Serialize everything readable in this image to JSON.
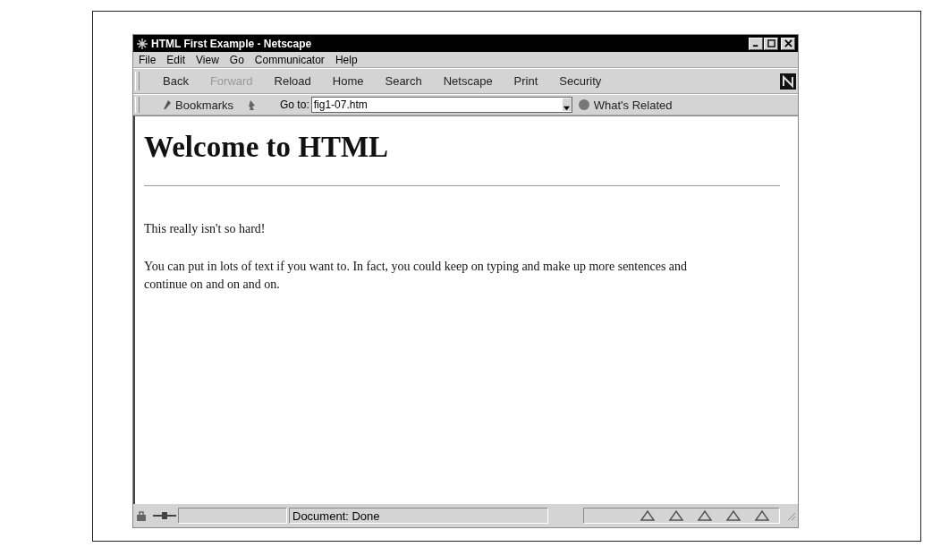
{
  "window": {
    "title": "HTML First Example - Netscape"
  },
  "menu": [
    "File",
    "Edit",
    "View",
    "Go",
    "Communicator",
    "Help"
  ],
  "toolbar": [
    {
      "label": "Back",
      "disabled": false
    },
    {
      "label": "Forward",
      "disabled": true
    },
    {
      "label": "Reload",
      "disabled": false
    },
    {
      "label": "Home",
      "disabled": false
    },
    {
      "label": "Search",
      "disabled": false
    },
    {
      "label": "Netscape",
      "disabled": false
    },
    {
      "label": "Print",
      "disabled": false
    },
    {
      "label": "Security",
      "disabled": false
    }
  ],
  "location_bar": {
    "bookmarks": "Bookmarks",
    "goto_label": "Go to:",
    "url": "fig1-07.htm",
    "related": "What's Related"
  },
  "page": {
    "heading": "Welcome to HTML",
    "paragraphs": [
      "This really isn't so hard!",
      "You can put in lots of text if you want to. In fact, you could keep on typing and make up more sentences and continue on and on and on."
    ]
  },
  "status_bar": {
    "text": "Document: Done"
  }
}
